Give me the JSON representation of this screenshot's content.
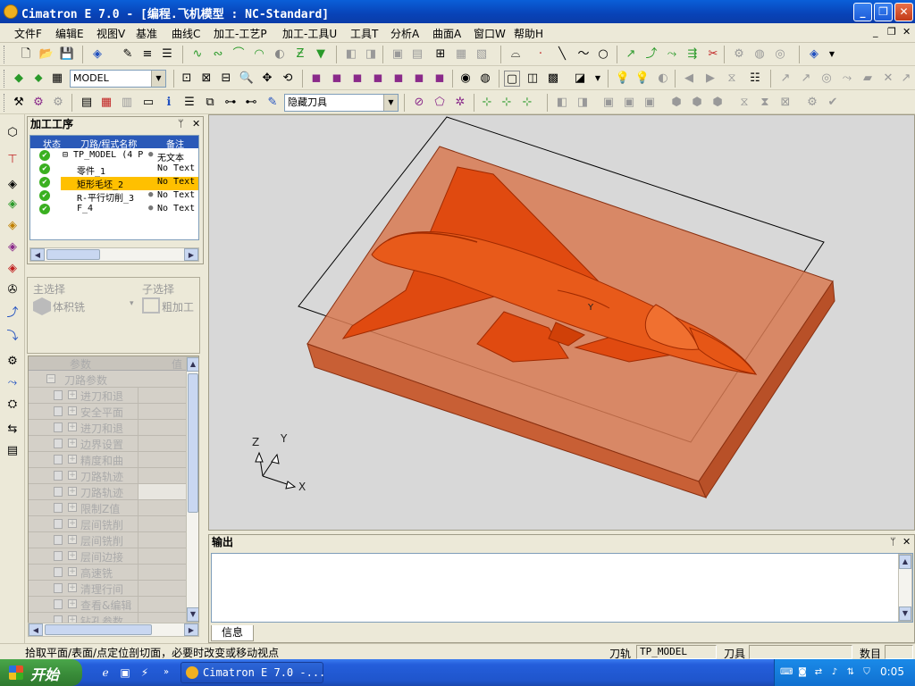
{
  "window": {
    "title": "Cimatron E 7.0 - [编程.飞机模型 : NC-Standard]",
    "min": "_",
    "max": "❐",
    "close": "✕"
  },
  "menu": {
    "items": [
      "文件F",
      "编辑E",
      "视图V",
      "基准",
      "曲线C",
      "加工-工艺P",
      "加工-工具U",
      "工具T",
      "分析A",
      "曲面A",
      "窗口W",
      "帮助H"
    ],
    "mdi_min": "_",
    "mdi_restore": "❐",
    "mdi_close": "✕"
  },
  "toolbar2": {
    "model_combo": "MODEL"
  },
  "toolbar3": {
    "tool_combo": "隐藏刀具"
  },
  "process_panel": {
    "title": "加工工序",
    "pin": "📌",
    "close": "✕",
    "columns": [
      "状态",
      "刀路/程式名称",
      "备注"
    ],
    "rows": [
      {
        "name": "⊟ TP_MODEL (4 P",
        "note": "无文本",
        "bulb": true
      },
      {
        "name": "零件_1",
        "note": "No Text",
        "bulb": false
      },
      {
        "name": "矩形毛坯_2",
        "note": "No Text",
        "bulb": false,
        "selected": true
      },
      {
        "name": "R-平行切削_3",
        "note": "No Text",
        "bulb": true
      },
      {
        "name": "F_4",
        "note": "No Text",
        "bulb": true
      }
    ]
  },
  "selection": {
    "main_label": "主选择",
    "sub_label": "子选择",
    "main_value": "体积铣",
    "sub_value": "粗加工"
  },
  "params": {
    "col_param": "参数",
    "col_value": "值",
    "root": "刀路参数",
    "items": [
      "进刀和退",
      "安全平面",
      "进刀和退",
      "边界设置",
      "精度和曲",
      "刀路轨迹",
      "刀路轨迹",
      "限制Z值",
      "层间铣削",
      "层间铣削",
      "层间边接",
      "高速铣",
      "清理行间",
      "查看&编辑",
      "钻孔参数"
    ]
  },
  "viewport": {
    "axes": {
      "x": "X",
      "y": "Y",
      "z": "Z"
    },
    "colors": {
      "background": "#d8d8d8",
      "model": "#e04a10",
      "stock": "#d86a3c",
      "outline": "#000000"
    }
  },
  "output": {
    "title": "输出",
    "tab": "信息"
  },
  "status": {
    "message": "拾取平面/表面/点定位剖切面，必要时改变或移动视点",
    "toolpath_label": "刀轨",
    "toolpath_value": "TP_MODEL",
    "tool_label": "刀具",
    "tool_value": "",
    "count_label": "数目",
    "count_value": ""
  },
  "taskbar": {
    "start": "开始",
    "task": "Cimatron E 7.0 -...",
    "clock": "0:05"
  }
}
